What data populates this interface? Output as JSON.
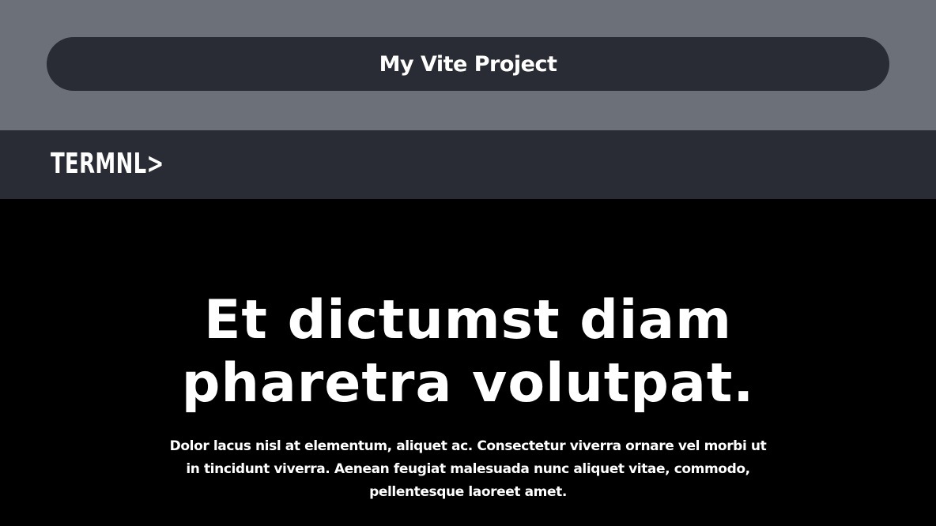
{
  "window": {
    "title": "My Vite Project"
  },
  "navbar": {
    "logo_text": "TERMNL>"
  },
  "hero": {
    "headline": "Et dictumst diam pharetra volutpat.",
    "body": "Dolor lacus nisl at elementum, aliquet ac. Consectetur viverra ornare vel morbi ut in tincidunt viverra. Aenean feugiat malesuada nunc aliquet vitae, commodo, pellentesque laoreet amet."
  },
  "colors": {
    "top_band": "#6b7079",
    "pill": "#292c34",
    "navbar": "#292c34",
    "hero_background": "#000000",
    "text": "#ffffff"
  }
}
